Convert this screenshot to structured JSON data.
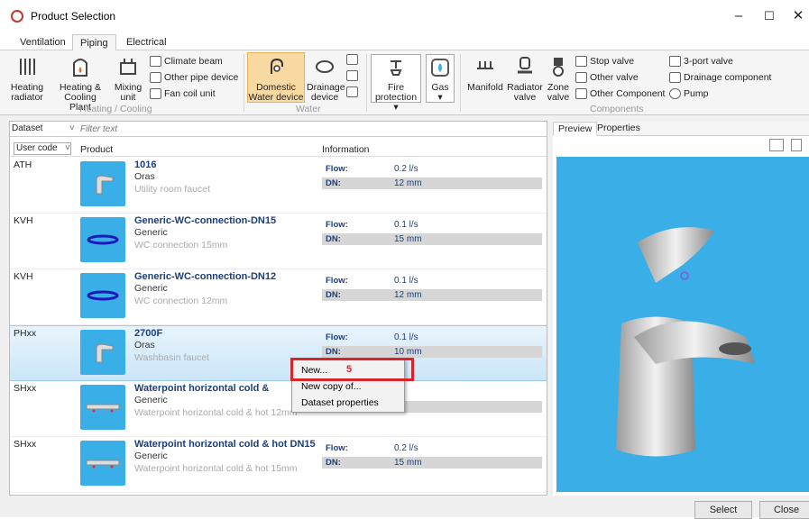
{
  "window": {
    "title": "Product Selection",
    "minimize": "–",
    "maximize": "☐",
    "close": "✕"
  },
  "tabs": [
    "Ventilation",
    "Piping",
    "Electrical"
  ],
  "ribbon": {
    "heating_radiator": [
      "Heating",
      "radiator"
    ],
    "heating_cooling_plant": [
      "Heating &",
      "Cooling Plant"
    ],
    "mixing_unit": [
      "Mixing",
      "unit"
    ],
    "climate_beam": "Climate beam",
    "other_pipe_device": "Other pipe device",
    "fan_coil_unit": "Fan coil unit",
    "group_heating": "Heating / Cooling",
    "domestic_water": [
      "Domestic",
      "Water device"
    ],
    "drainage_device": [
      "Drainage",
      "device"
    ],
    "group_water": "Water",
    "fire_protection": [
      "Fire",
      "protection ▾"
    ],
    "gas": [
      "Gas",
      "▾"
    ],
    "manifold": "Manifold",
    "radiator_valve": [
      "Radiator",
      "valve"
    ],
    "zone_valve": [
      "Zone",
      "valve"
    ],
    "stop_valve": "Stop valve",
    "other_valve": "Other valve",
    "other_component": "Other Component",
    "three_port_valve": "3-port valve",
    "drainage_component": "Drainage component",
    "pump": "Pump",
    "group_components": "Components"
  },
  "filter": {
    "dataset": "Dataset",
    "placeholder": "Filter text"
  },
  "columns": {
    "user_code": "User code",
    "product": "Product",
    "information": "Information"
  },
  "info_labels": {
    "flow": "Flow:",
    "dn": "DN:"
  },
  "products": [
    {
      "code": "ATH",
      "name": "1016",
      "manufacturer": "Oras",
      "description": "Utility room faucet",
      "flow": "0.2 l/s",
      "dn": "12 mm"
    },
    {
      "code": "KVH",
      "name": "Generic-WC-connection-DN15",
      "manufacturer": "Generic",
      "description": "WC connection 15mm",
      "flow": "0.1 l/s",
      "dn": "15 mm"
    },
    {
      "code": "KVH",
      "name": "Generic-WC-connection-DN12",
      "manufacturer": "Generic",
      "description": "WC connection 12mm",
      "flow": "0.1 l/s",
      "dn": "12 mm"
    },
    {
      "code": "PHxx",
      "name": "2700F",
      "manufacturer": "Oras",
      "description": "Washbasin faucet",
      "flow": "0.1 l/s",
      "dn": "10 mm"
    },
    {
      "code": "SHxx",
      "name": "Waterpoint horizontal cold &",
      "manufacturer": "Generic",
      "description": "Waterpoint horizontal cold & hot 12mm",
      "flow": "s",
      "dn": "m"
    },
    {
      "code": "SHxx",
      "name": "Waterpoint horizontal cold & hot DN15",
      "manufacturer": "Generic",
      "description": "Waterpoint horizontal cold & hot 15mm",
      "flow": "0.2 l/s",
      "dn": "15 mm"
    }
  ],
  "right_tabs": [
    "Preview",
    "Properties"
  ],
  "context_menu": [
    "New...",
    "New copy of...",
    "Dataset properties"
  ],
  "annotation": "5",
  "buttons": {
    "select": "Select",
    "close": "Close"
  },
  "colors": {
    "preview_bg": "#3aaee6",
    "highlight": "#f8d9a2",
    "annotation": "#d7262a",
    "link": "#1c3e7a"
  }
}
